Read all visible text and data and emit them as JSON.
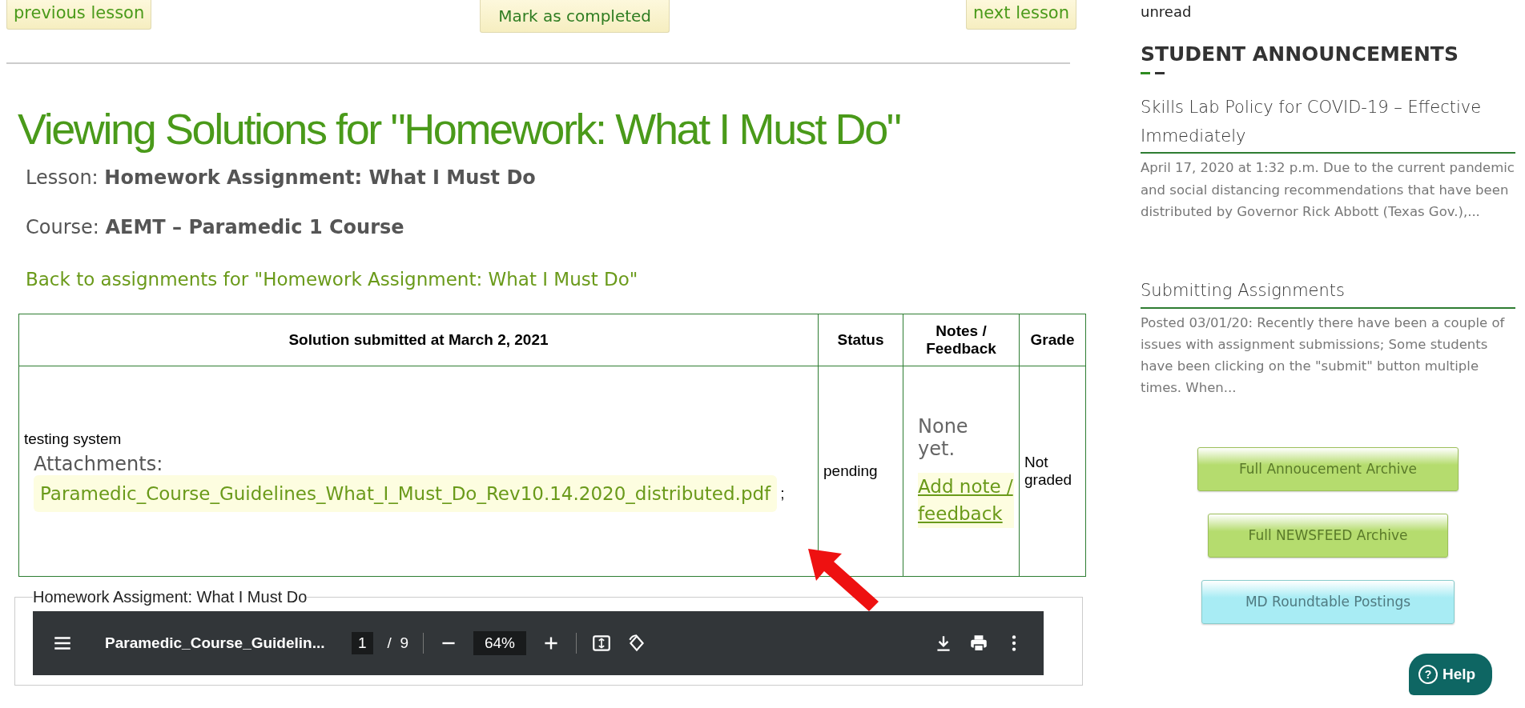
{
  "nav": {
    "previous": "previous lesson",
    "complete": "Mark as completed",
    "next": "next lesson"
  },
  "title": "Viewing Solutions for \"Homework: What I Must Do\"",
  "details": [
    {
      "label": "Lesson:",
      "value": "Homework Assignment: What I Must Do"
    },
    {
      "label": "Course:",
      "value": "AEMT – Paramedic 1 Course"
    }
  ],
  "back_link": "Back to assignments for \"Homework Assignment: What I Must Do\"",
  "table": {
    "columns": [
      "Solution submitted at March 2, 2021",
      "Status",
      "Notes / Feedback",
      "Grade"
    ],
    "rows": [
      {
        "solution": "testing system",
        "attachments_label": "Attachments:",
        "attachment": "Paramedic_Course_Guidelines_What_I_Must_Do_Rev10.14.2020_distributed.pdf",
        "separator": ";",
        "status": "pending",
        "notes": "None yet.",
        "notes_link": "Add note / feedback",
        "grade": "Not graded"
      }
    ]
  },
  "viewer": {
    "legend": "Homework Assigment: What I Must Do",
    "file_name": "Paramedic_Course_Guidelin...",
    "page": "1",
    "page_count": "/  9",
    "zoom": "64%"
  },
  "sidebar": {
    "unread": "unread",
    "heading": "STUDENT ANNOUNCEMENTS",
    "announcements": [
      {
        "title": "Skills Lab Policy for COVID-19 – Effective Immediately",
        "excerpt": "April 17, 2020 at 1:32 p.m. Due to the current pandemic and social distancing recommendations that have been distributed by Governor Rick Abbott (Texas Gov.),..."
      },
      {
        "title": "Submitting Assignments",
        "excerpt": "Posted 03/01/20: Recently there have been a couple of issues with assignment submissions; Some students have been clicking on the \"submit\" button multiple times. When..."
      }
    ],
    "buttons": [
      {
        "label": "Full Annoucement Archive",
        "color": "#b5dc6e"
      },
      {
        "label": "Full NEWSFEED Archive",
        "color": "#b5dc6e"
      },
      {
        "label": "MD Roundtable Postings",
        "color": "#a8ecf4"
      }
    ]
  },
  "help": {
    "icon": "?",
    "label": "Help"
  }
}
